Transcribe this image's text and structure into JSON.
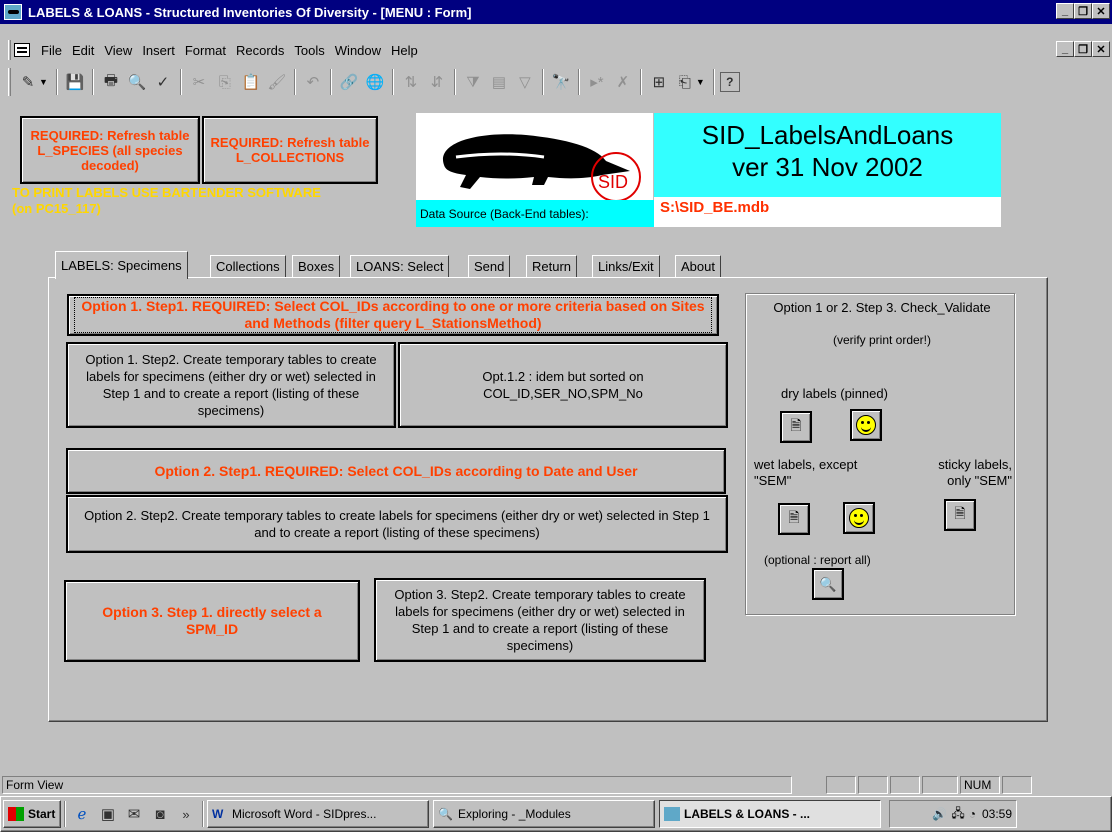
{
  "window": {
    "title": "LABELS & LOANS - Structured Inventories Of Diversity - [MENU : Form]"
  },
  "menu": [
    "File",
    "Edit",
    "View",
    "Insert",
    "Format",
    "Records",
    "Tools",
    "Window",
    "Help"
  ],
  "header": {
    "refresh_species_label": "REQUIRED: Refresh table L_SPECIES (all species decoded)",
    "refresh_collections_label": "REQUIRED: Refresh table L_COLLECTIONS",
    "print_note": "TO PRINT LABELS USE  BARTENDER SOFTWARE (on PC15_117)",
    "logo_text": "SID",
    "app_name": "SID_LabelsAndLoans",
    "app_version": "ver 31 Nov 2002",
    "data_source_label": "Data Source (Back-End tables):",
    "data_source_value": "S:\\SID_BE.mdb"
  },
  "tabs": [
    "LABELS: Specimens",
    "Collections",
    "Boxes",
    "LOANS: Select",
    "Send",
    "Return",
    "Links/Exit",
    "About"
  ],
  "options": {
    "opt1_step1": "Option 1. Step1. REQUIRED: Select COL_IDs according to one or more criteria based on Sites and Methods (filter query    L_StationsMethod)",
    "opt1_step2": "Option 1. Step2. Create temporary tables to create labels for specimens (either dry or wet) selected in Step 1 and to create a report (listing of these specimens)",
    "opt12": "Opt.1.2 : idem but sorted on COL_ID,SER_NO,SPM_No",
    "opt2_step1": "Option 2. Step1. REQUIRED: Select COL_IDs according to Date and User",
    "opt2_step2": "Option 2. Step2. Create temporary tables to create labels for specimens (either dry or wet) selected in Step 1 and to create a report (listing of these specimens)",
    "opt3_step1": "Option 3. Step 1. directly select a SPM_ID",
    "opt3_step2": "Option 3. Step2. Create temporary tables to create labels for specimens (either dry or wet) selected in Step 1 and to create a report (listing of these specimens)"
  },
  "validate_group": {
    "title": "Option 1 or 2. Step 3. Check_Validate",
    "subtitle": "(verify print order!)",
    "dry_label": "dry labels (pinned)",
    "wet_label": "wet labels, except \"SEM\"",
    "sticky_label": "sticky labels, only \"SEM\"",
    "optional_label": "(optional : report all)"
  },
  "status": {
    "left": "Form View",
    "num": "NUM"
  },
  "taskbar": {
    "start": "Start",
    "tasks": [
      "Microsoft Word - SIDpres...",
      "Exploring - _Modules",
      "LABELS & LOANS - ..."
    ],
    "clock": "03:59"
  }
}
